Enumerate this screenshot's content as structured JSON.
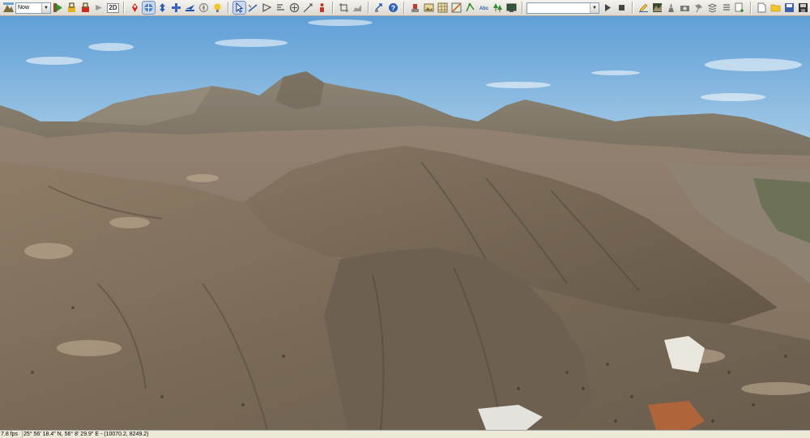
{
  "toolbar": {
    "time_select": {
      "value": "Now"
    },
    "view_mode_label": "2D",
    "search_combo": {
      "value": ""
    },
    "buttons_group1": [
      "terrain-view-icon",
      "play-green-icon",
      "lock-yellow-icon",
      "lock-red-icon",
      "forward-gray-icon"
    ],
    "buttons_group2": [
      "pin-red-icon",
      "globe-rotate-icon",
      "arrow-up-down-icon",
      "pan-cross-icon",
      "fly-icon",
      "compass-gray-icon",
      "lightbulb-icon"
    ],
    "buttons_group3": [
      "select-arrow-icon",
      "measure-line-icon",
      "measure-area-icon",
      "measure-height-icon",
      "circle-target-icon",
      "slope-icon",
      "person-marker-icon"
    ],
    "buttons_group4": [
      "crop-icon",
      "profile-icon"
    ],
    "buttons_group5": [
      "move-blue-icon",
      "help-icon"
    ],
    "buttons_group6": [
      "flag-red-icon",
      "image-layer-icon",
      "grid-layer-icon",
      "road-layer-icon",
      "vector-green-icon",
      "label-abc-icon",
      "tree-layer-icon",
      "tv-layer-icon"
    ],
    "media_buttons": [
      "play-icon",
      "stop-icon"
    ],
    "buttons_group7": [
      "draw-pencil-icon",
      "terrain-3d-icon",
      "tower-icon",
      "camera-icon",
      "satellite-icon",
      "stack-layers-icon",
      "list-icon",
      "add-page-icon",
      "new-doc-icon",
      "open-folder-icon",
      "save-as-icon",
      "save-floppy-icon"
    ]
  },
  "status": {
    "fps": "7.8 fps",
    "coordinates": "25°  56' 18.4\" N, 56°  8' 29.9\" E  -  (10070.2, 8249.2)"
  },
  "colors": {
    "sky_top": "#5f9fd6",
    "sky_bottom": "#a9cde8",
    "terrain_light": "#a08f78",
    "terrain_dark": "#5c5244"
  }
}
